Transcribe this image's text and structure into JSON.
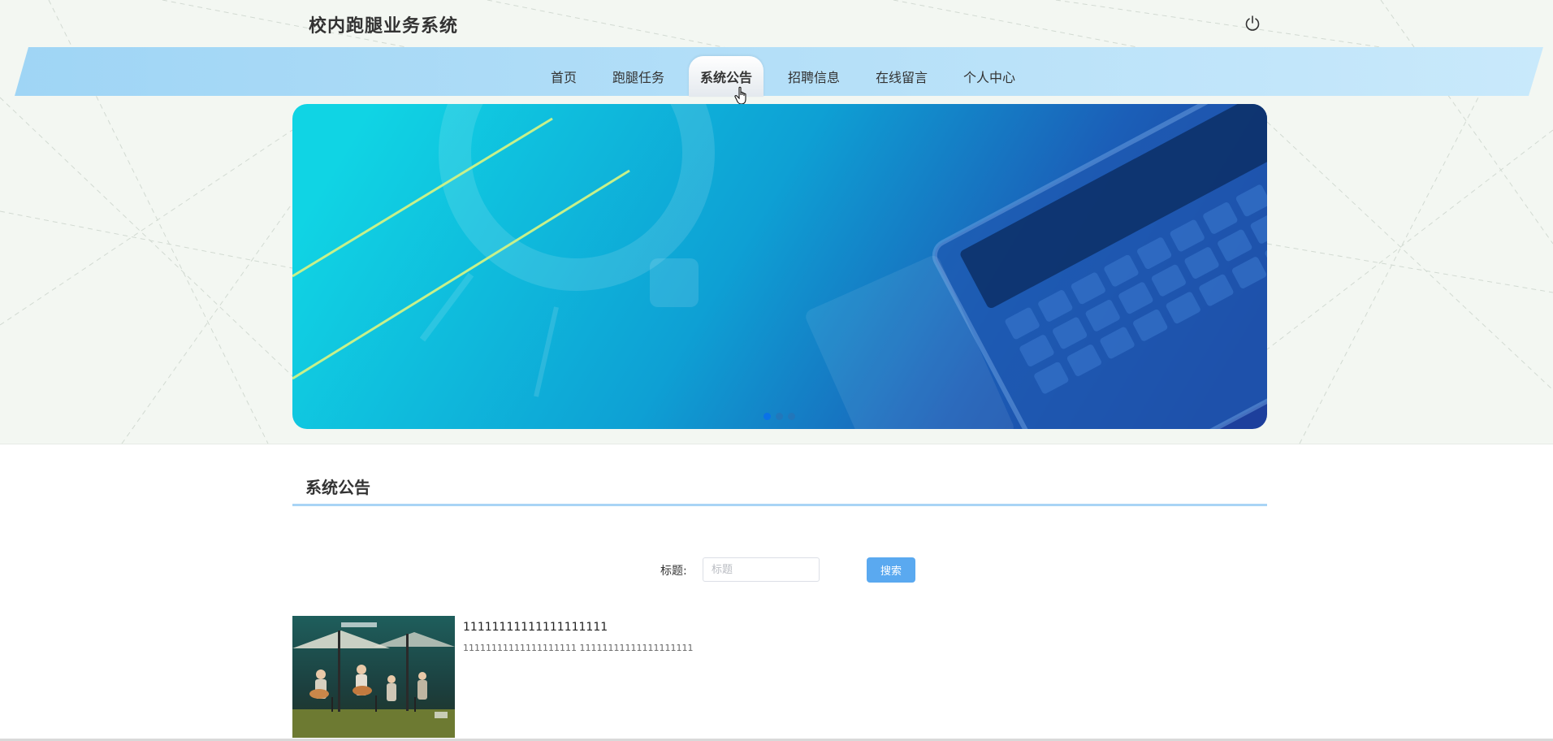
{
  "header": {
    "site_title": "校内跑腿业务系统",
    "logout_icon": "power-icon"
  },
  "nav": {
    "items": [
      {
        "label": "首页",
        "active": false
      },
      {
        "label": "跑腿任务",
        "active": false
      },
      {
        "label": "系统公告",
        "active": true
      },
      {
        "label": "招聘信息",
        "active": false
      },
      {
        "label": "在线留言",
        "active": false
      },
      {
        "label": "个人中心",
        "active": false
      }
    ]
  },
  "banner": {
    "slides_total": 3,
    "active_slide": 1
  },
  "section": {
    "title": "系统公告"
  },
  "search": {
    "label": "标题:",
    "placeholder": "标题",
    "value": "",
    "button_label": "搜索"
  },
  "notices": [
    {
      "title": "11111111111111111111",
      "description": "11111111111111111111 11111111111111111111"
    }
  ],
  "colors": {
    "accent": "#5aa9f0",
    "nav_band": "#a6d8f6",
    "section_rule": "#a9d4f5",
    "page_bg": "#f3f7f2"
  }
}
